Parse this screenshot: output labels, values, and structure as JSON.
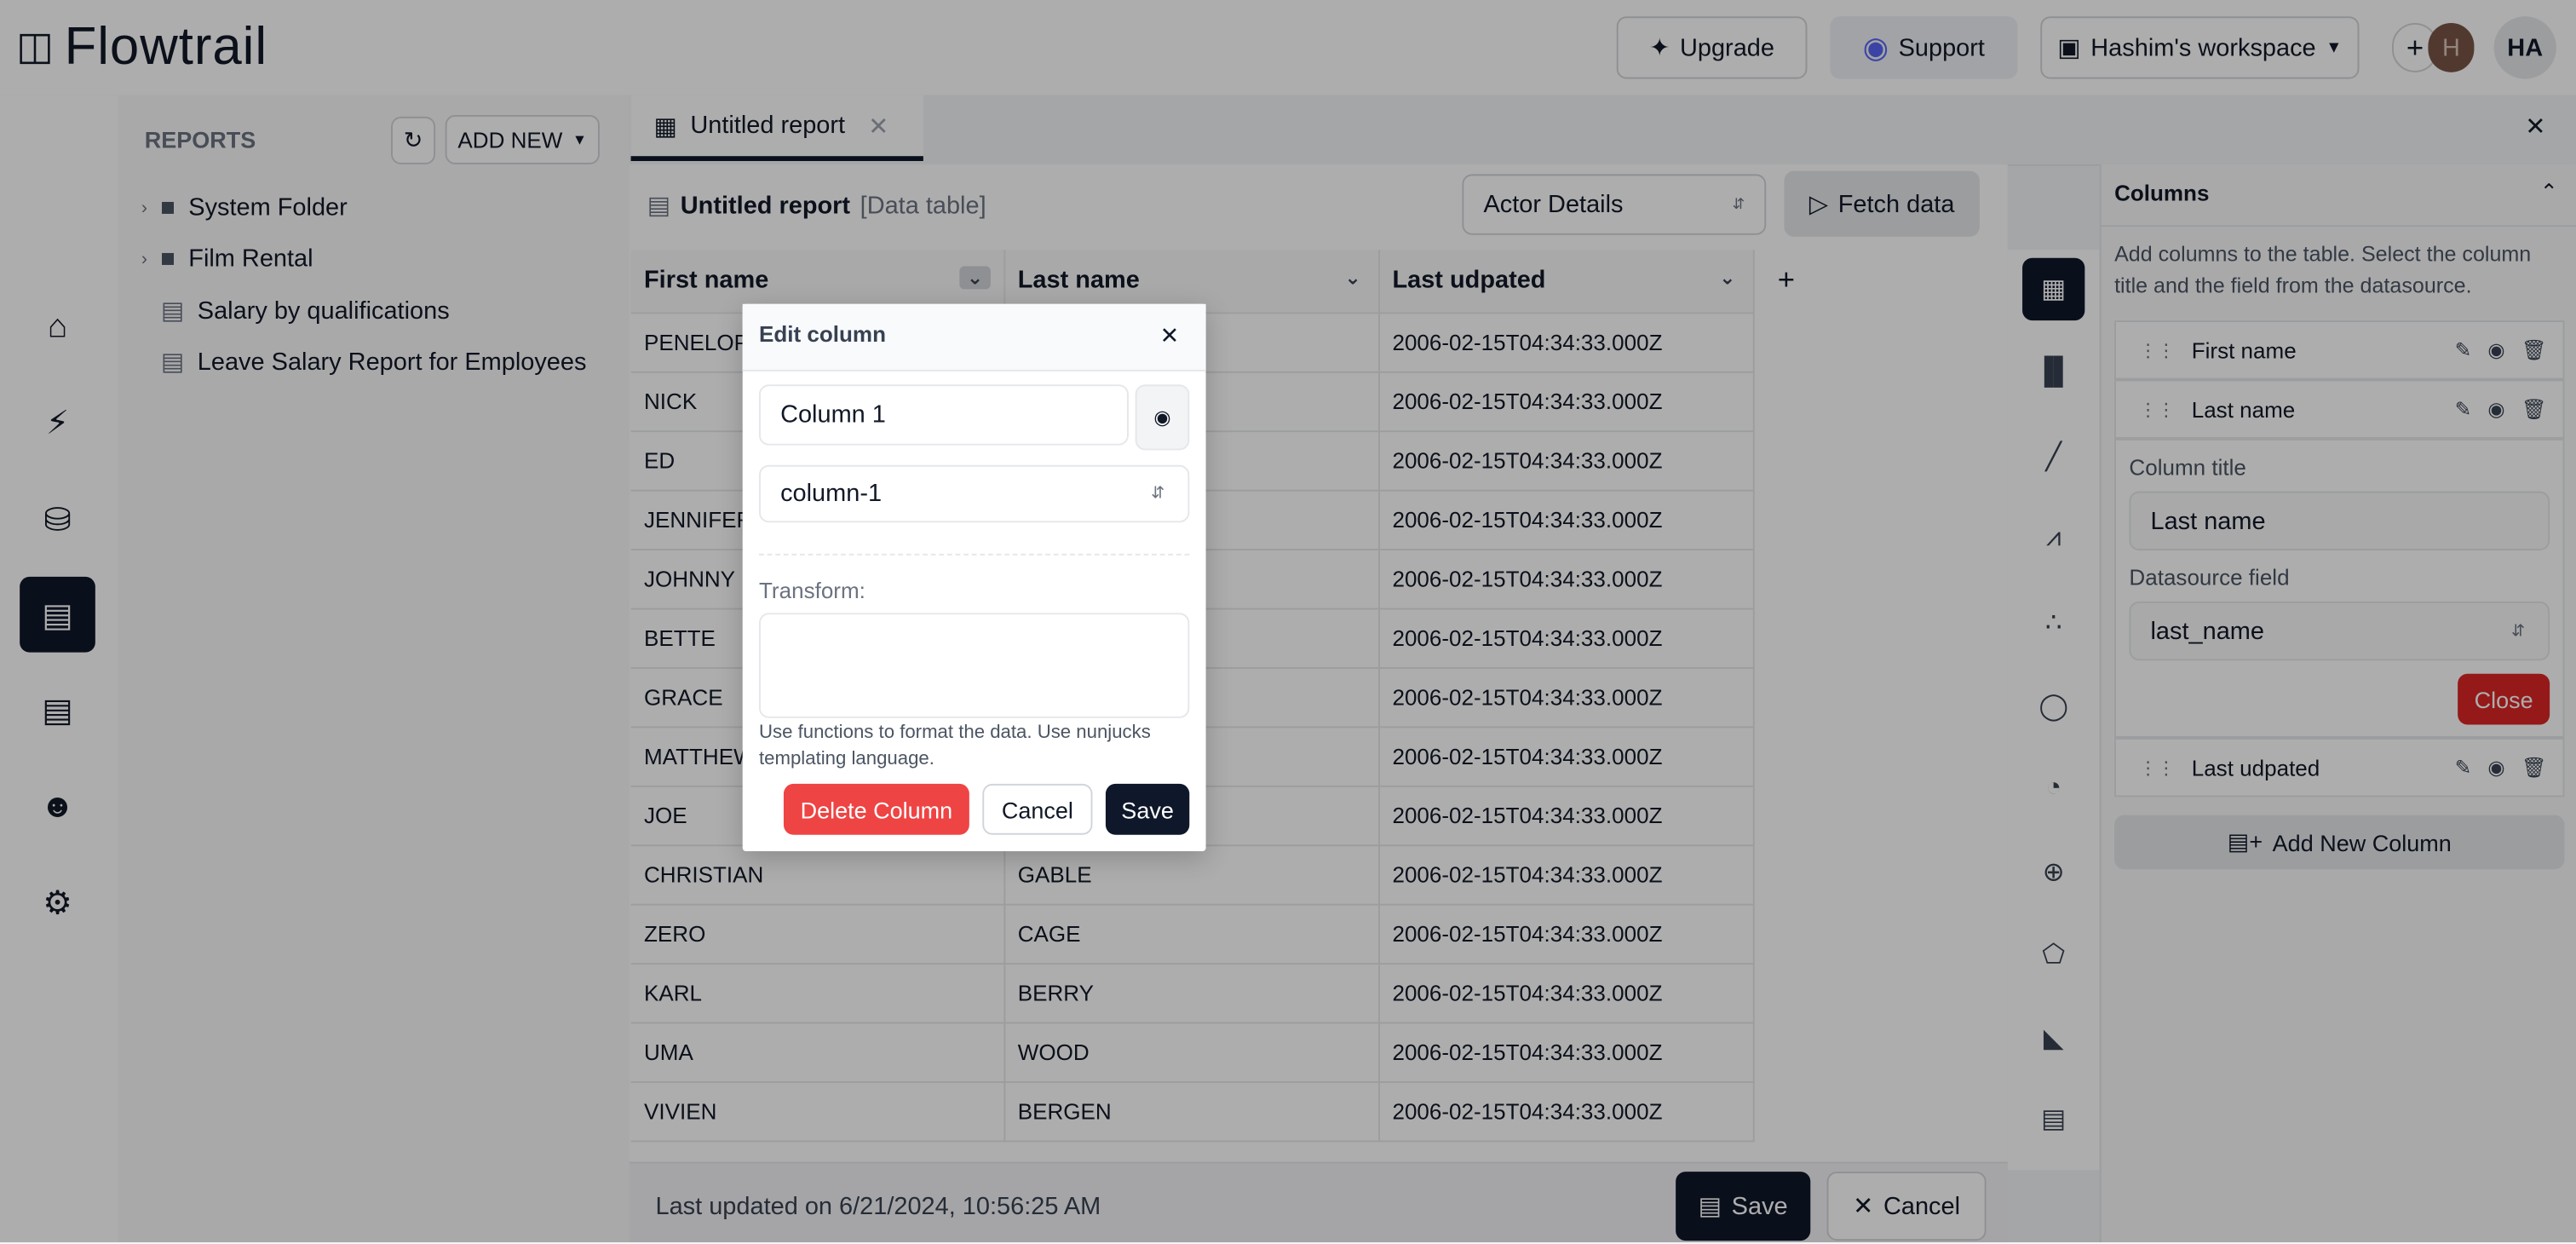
{
  "header": {
    "logo": "Flowtrail",
    "upgrade": "Upgrade",
    "support": "Support",
    "workspace": "Hashim's workspace",
    "avatar_initial": "H",
    "user_initials": "HA"
  },
  "sidebar": {
    "icons": [
      "home-icon",
      "plug-icon",
      "database-settings-icon",
      "chart-icon",
      "report-icon",
      "bot-icon",
      "gear-icon"
    ],
    "active": "chart-icon"
  },
  "reports": {
    "title": "REPORTS",
    "add_new": "ADD NEW",
    "items": [
      {
        "label": "System Folder",
        "type": "folder"
      },
      {
        "label": "Film Rental",
        "type": "folder"
      },
      {
        "label": "Salary by qualifications",
        "type": "report"
      },
      {
        "label": "Leave Salary Report for Employees",
        "type": "report"
      }
    ]
  },
  "tabs": [
    {
      "label": "Untitled report",
      "active": true
    }
  ],
  "report": {
    "title": "Untitled report",
    "type": "[Data table]",
    "datasource": "Actor Details",
    "fetch": "Fetch data"
  },
  "table": {
    "columns": [
      "First name",
      "Last name",
      "Last udpated"
    ],
    "rows": [
      [
        "PENELOPE",
        "",
        "2006-02-15T04:34:33.000Z"
      ],
      [
        "NICK",
        "",
        "2006-02-15T04:34:33.000Z"
      ],
      [
        "ED",
        "",
        "2006-02-15T04:34:33.000Z"
      ],
      [
        "JENNIFER",
        "",
        "2006-02-15T04:34:33.000Z"
      ],
      [
        "JOHNNY",
        "",
        "2006-02-15T04:34:33.000Z"
      ],
      [
        "BETTE",
        "",
        "2006-02-15T04:34:33.000Z"
      ],
      [
        "GRACE",
        "",
        "2006-02-15T04:34:33.000Z"
      ],
      [
        "MATTHEW",
        "",
        "2006-02-15T04:34:33.000Z"
      ],
      [
        "JOE",
        "",
        "2006-02-15T04:34:33.000Z"
      ],
      [
        "CHRISTIAN",
        "GABLE",
        "2006-02-15T04:34:33.000Z"
      ],
      [
        "ZERO",
        "CAGE",
        "2006-02-15T04:34:33.000Z"
      ],
      [
        "KARL",
        "BERRY",
        "2006-02-15T04:34:33.000Z"
      ],
      [
        "UMA",
        "WOOD",
        "2006-02-15T04:34:33.000Z"
      ],
      [
        "VIVIEN",
        "BERGEN",
        "2006-02-15T04:34:33.000Z"
      ]
    ]
  },
  "chart_types": [
    "table-icon",
    "bar-chart-icon",
    "line-chart-icon",
    "multi-line-chart-icon",
    "scatter-icon",
    "donut-icon",
    "pie-icon",
    "radar-icon",
    "pentagon-icon",
    "area-chart-icon",
    "dashboard-icon"
  ],
  "columns_panel": {
    "title": "Columns",
    "description": "Add columns to the table. Select the column title and the field from the datasource.",
    "items": [
      "First name",
      "Last name",
      "Last udpated"
    ],
    "column_title_label": "Column title",
    "column_title_value": "Last name",
    "datasource_label": "Datasource field",
    "datasource_value": "last_name",
    "close": "Close",
    "add_new": "Add New Column"
  },
  "footer": {
    "last_updated": "Last updated on 6/21/2024, 10:56:25 AM",
    "save": "Save",
    "cancel": "Cancel"
  },
  "modal": {
    "title": "Edit column",
    "column_name": "Column 1",
    "field": "column-1",
    "transform_label": "Transform:",
    "transform_value": "",
    "help": "Use functions to format the data. Use nunjucks templating language.",
    "delete": "Delete Column",
    "cancel": "Cancel",
    "save": "Save"
  },
  "colors": {
    "primary": "#0f172a",
    "danger": "#ef4444",
    "discord": "#5865f2"
  }
}
